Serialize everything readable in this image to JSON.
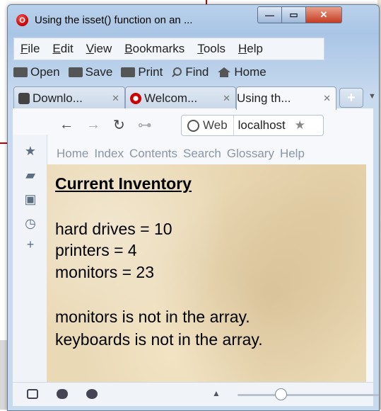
{
  "window": {
    "title": "Using the isset() function on an ...",
    "controls": {
      "minimize": "—",
      "maximize": "▭",
      "close": "✕"
    }
  },
  "menubar": {
    "items": [
      {
        "u": "F",
        "rest": "ile"
      },
      {
        "u": "E",
        "rest": "dit"
      },
      {
        "u": "V",
        "rest": "iew"
      },
      {
        "u": "B",
        "rest": "ookmarks"
      },
      {
        "u": "T",
        "rest": "ools"
      },
      {
        "u": "H",
        "rest": "elp"
      }
    ]
  },
  "toolbar": {
    "open": "Open",
    "save": "Save",
    "print": "Print",
    "find": "Find",
    "home": "Home"
  },
  "tabs": [
    {
      "label": "Downlo...",
      "icon": "pocket-icon"
    },
    {
      "label": "Welcom...",
      "icon": "opera-icon"
    },
    {
      "label": "Using th...",
      "icon": "page-icon",
      "active": true
    }
  ],
  "newtab": "+",
  "navbar": {
    "identity": "Web",
    "url": "localhost",
    "star": "★"
  },
  "helplinks": [
    "Home",
    "Index",
    "Contents",
    "Search",
    "Glossary",
    "Help"
  ],
  "page": {
    "heading": "Current Inventory",
    "lines": [
      "hard drives = 10",
      "printers = 4",
      "monitors = 23",
      "monitors is not in the array.",
      "keyboards is not in the array."
    ]
  },
  "statusbar": {
    "zoom_fraction": 0.3
  },
  "colors": {
    "page_background": "#ead9b5",
    "title_accent": "#c00000"
  }
}
